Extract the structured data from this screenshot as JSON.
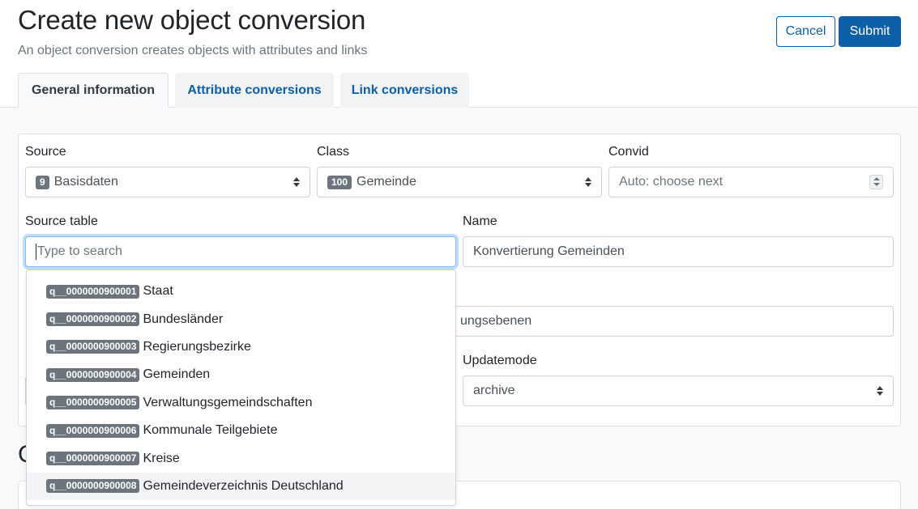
{
  "header": {
    "title": "Create new object conversion",
    "subtitle": "An object conversion creates objects with attributes and links",
    "cancel_label": "Cancel",
    "submit_label": "Submit"
  },
  "tabs": [
    {
      "label": "General information",
      "active": true
    },
    {
      "label": "Attribute conversions",
      "active": false
    },
    {
      "label": "Link conversions",
      "active": false
    }
  ],
  "form": {
    "source": {
      "label": "Source",
      "badge": "9",
      "value": "Basisdaten"
    },
    "class": {
      "label": "Class",
      "badge": "100",
      "value": "Gemeinde"
    },
    "convid": {
      "label": "Convid",
      "placeholder": "Auto: choose next"
    },
    "source_table": {
      "label": "Source table",
      "placeholder": "Type to search"
    },
    "name": {
      "label": "Name",
      "value": "Konvertierung Gemeinden"
    },
    "hidden_field_partial": "ungsebenen",
    "updatemode": {
      "label": "Updatemode",
      "value": "archive"
    }
  },
  "dropdown": {
    "items": [
      {
        "badge": "q__0000000900001",
        "label": "Staat"
      },
      {
        "badge": "q__0000000900002",
        "label": "Bundesländer"
      },
      {
        "badge": "q__0000000900003",
        "label": "Regierungsbezirke"
      },
      {
        "badge": "q__0000000900004",
        "label": "Gemeinden"
      },
      {
        "badge": "q__0000000900005",
        "label": "Verwaltungsgemeindschaften"
      },
      {
        "badge": "q__0000000900006",
        "label": "Kommunale Teilgebiete"
      },
      {
        "badge": "q__0000000900007",
        "label": "Kreise"
      },
      {
        "badge": "q__0000000900008",
        "label": "Gemeindeverzeichnis Deutschland"
      }
    ]
  },
  "section2": {
    "heading_partial": "C"
  },
  "colors": {
    "primary": "#0d5fa8",
    "badge": "#6c757d",
    "focus": "#80bdff"
  }
}
